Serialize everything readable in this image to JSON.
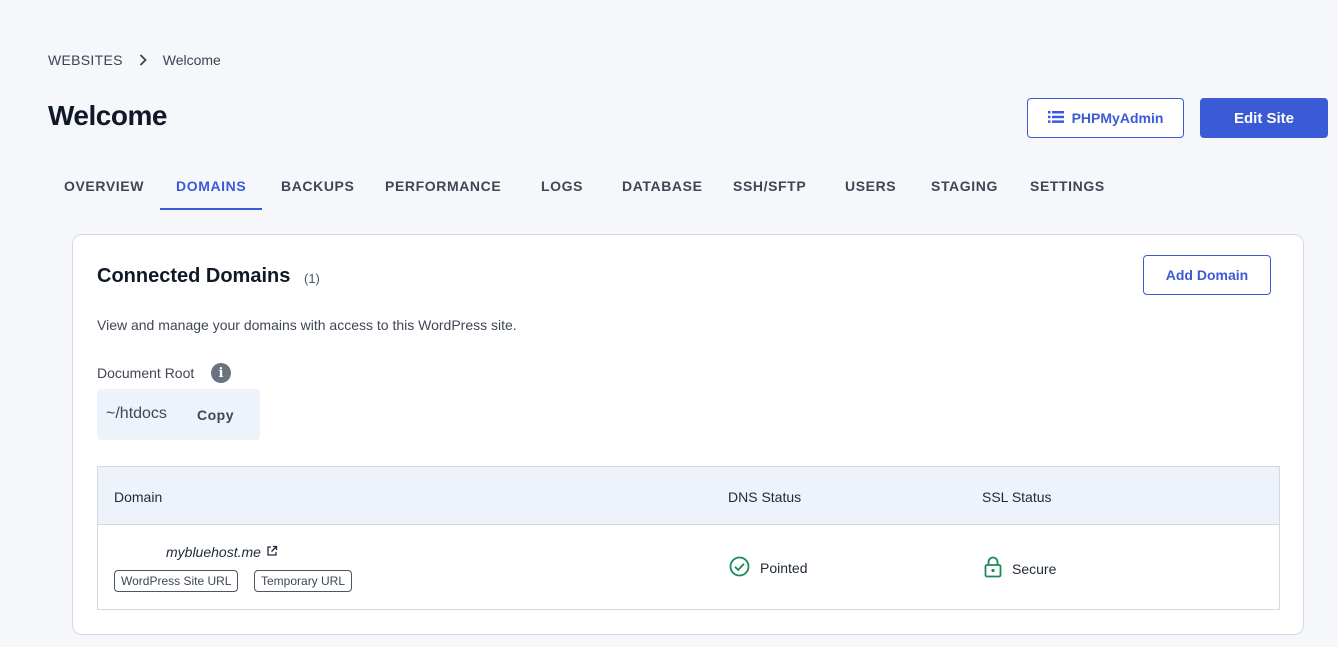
{
  "breadcrumb": {
    "root": "WEBSITES",
    "current": "Welcome"
  },
  "page": {
    "title": "Welcome"
  },
  "header_actions": {
    "phpmyadmin_label": "PHPMyAdmin",
    "edit_site_label": "Edit Site"
  },
  "tabs": [
    "OVERVIEW",
    "DOMAINS",
    "BACKUPS",
    "PERFORMANCE",
    "LOGS",
    "DATABASE",
    "SSH/SFTP",
    "USERS",
    "STAGING",
    "SETTINGS"
  ],
  "active_tab": "DOMAINS",
  "card": {
    "title": "Connected Domains",
    "count": "(1)",
    "add_domain_label": "Add Domain",
    "description": "View and manage your domains with access to this WordPress site.",
    "document_root_label": "Document Root",
    "document_root_path": "~/htdocs",
    "copy_label": "Copy"
  },
  "table": {
    "headers": {
      "domain": "Domain",
      "dns": "DNS Status",
      "ssl": "SSL Status"
    },
    "rows": [
      {
        "domain": "mybluehost.me",
        "tags": [
          "WordPress Site URL",
          "Temporary URL"
        ],
        "dns_status": "Pointed",
        "ssl_status": "Secure"
      }
    ]
  },
  "colors": {
    "accent": "#3b5bd6",
    "success": "#1a8a5a",
    "background": "#f5f7fb"
  },
  "icons": [
    "chevron-right-icon",
    "list-icon",
    "info-icon",
    "external-link-icon",
    "check-circle-icon",
    "lock-icon"
  ]
}
